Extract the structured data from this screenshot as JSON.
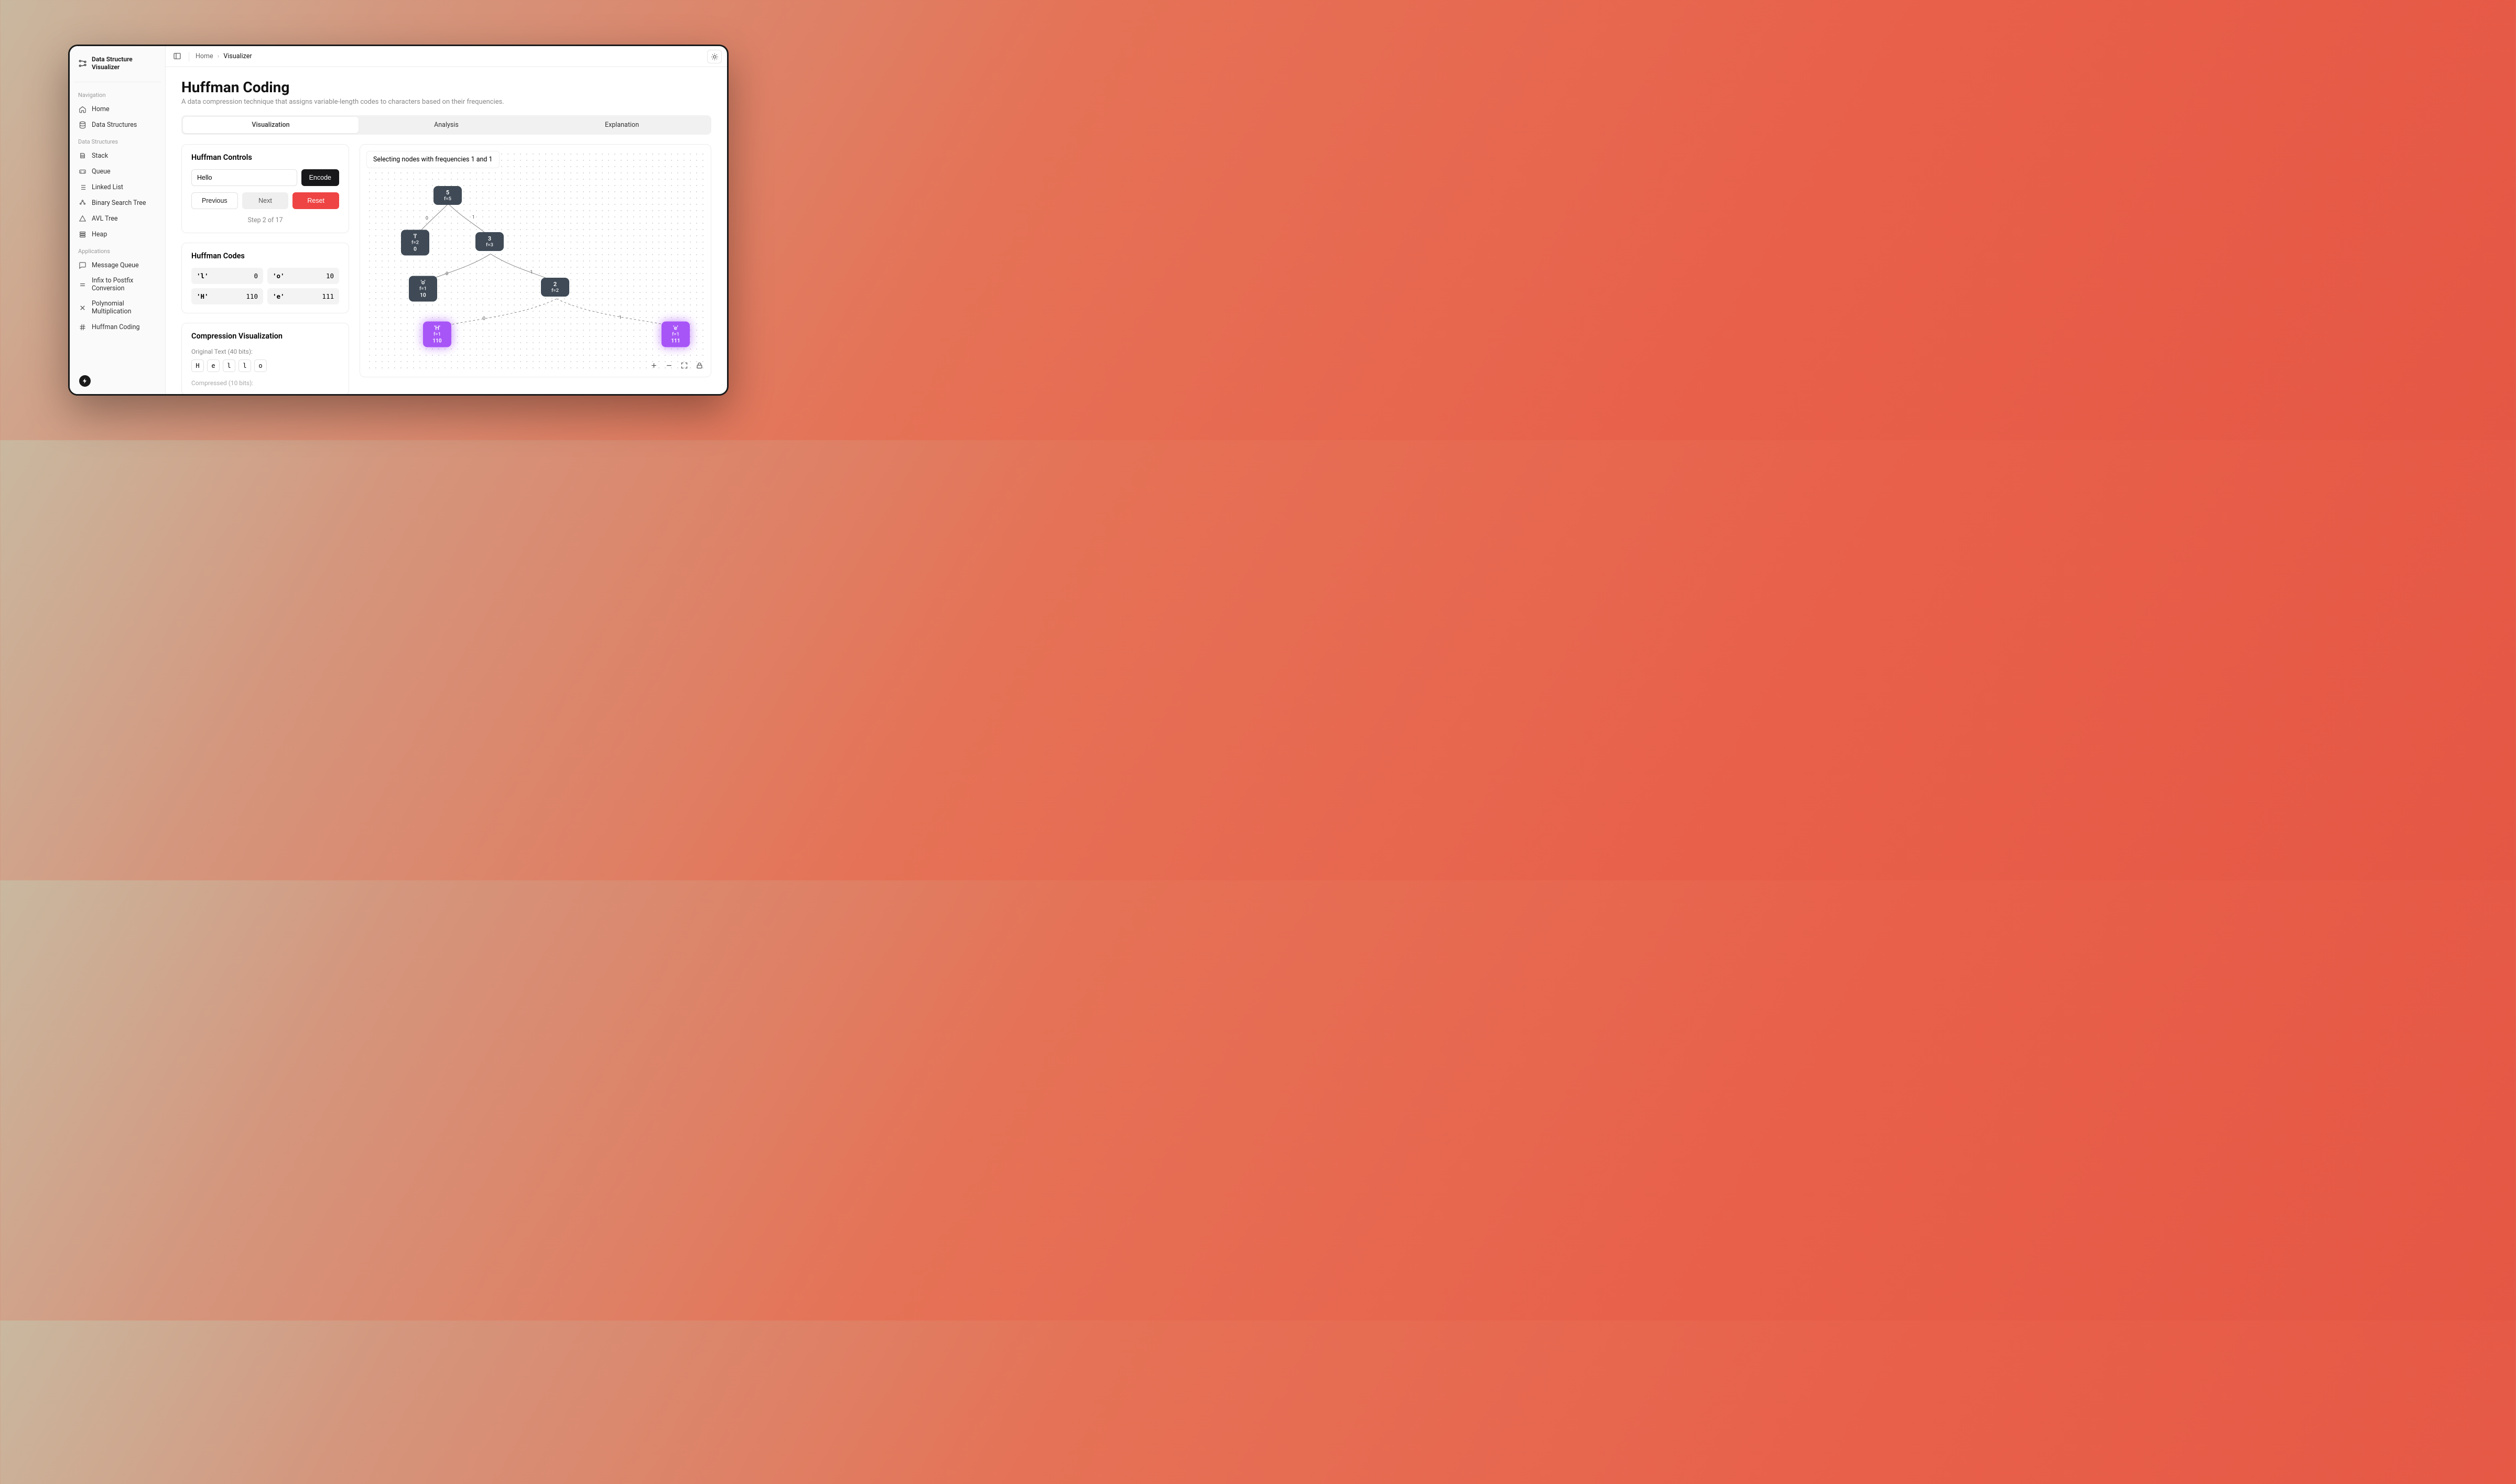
{
  "brand": {
    "line1": "Data Structure",
    "line2": "Visualizer"
  },
  "sections": {
    "nav_label": "Navigation",
    "nav": [
      {
        "label": "Home"
      },
      {
        "label": "Data Structures"
      }
    ],
    "ds_label": "Data Structures",
    "ds": [
      {
        "label": "Stack"
      },
      {
        "label": "Queue"
      },
      {
        "label": "Linked List"
      },
      {
        "label": "Binary Search Tree"
      },
      {
        "label": "AVL Tree"
      },
      {
        "label": "Heap"
      }
    ],
    "apps_label": "Applications",
    "apps": [
      {
        "label": "Message Queue"
      },
      {
        "label": "Infix to Postfix Conversion"
      },
      {
        "label": "Polynomial Multiplication"
      },
      {
        "label": "Huffman Coding"
      }
    ]
  },
  "breadcrumb": {
    "home": "Home",
    "current": "Visualizer"
  },
  "page": {
    "title": "Huffman Coding",
    "subtitle": "A data compression technique that assigns variable-length codes to characters based on their frequencies."
  },
  "tabs": {
    "t1": "Visualization",
    "t2": "Analysis",
    "t3": "Explanation"
  },
  "controls": {
    "title": "Huffman Controls",
    "input_value": "Hello",
    "encode": "Encode",
    "prev": "Previous",
    "next": "Next",
    "reset": "Reset",
    "step": "Step 2 of 17"
  },
  "codes": {
    "title": "Huffman Codes",
    "items": [
      {
        "k": "'l'",
        "v": "0"
      },
      {
        "k": "'o'",
        "v": "10"
      },
      {
        "k": "'H'",
        "v": "110"
      },
      {
        "k": "'e'",
        "v": "111"
      }
    ]
  },
  "compression": {
    "title": "Compression Visualization",
    "orig_label": "Original Text (40 bits):",
    "chars": [
      "H",
      "e",
      "l",
      "l",
      "o"
    ],
    "next_label": "Compressed (10 bits):"
  },
  "viz": {
    "status": "Selecting nodes with frequencies 1 and 1",
    "nodes": {
      "root": {
        "t": "5",
        "f": "f=5",
        "code": ""
      },
      "l": {
        "t": "'l'",
        "f": "f=2",
        "code": "0"
      },
      "three": {
        "t": "3",
        "f": "f=3",
        "code": ""
      },
      "o": {
        "t": "'o'",
        "f": "f=1",
        "code": "10"
      },
      "two": {
        "t": "2",
        "f": "f=2",
        "code": ""
      },
      "H": {
        "t": "'H'",
        "f": "f=1",
        "code": "110"
      },
      "e": {
        "t": "'e'",
        "f": "f=1",
        "code": "111"
      }
    }
  }
}
